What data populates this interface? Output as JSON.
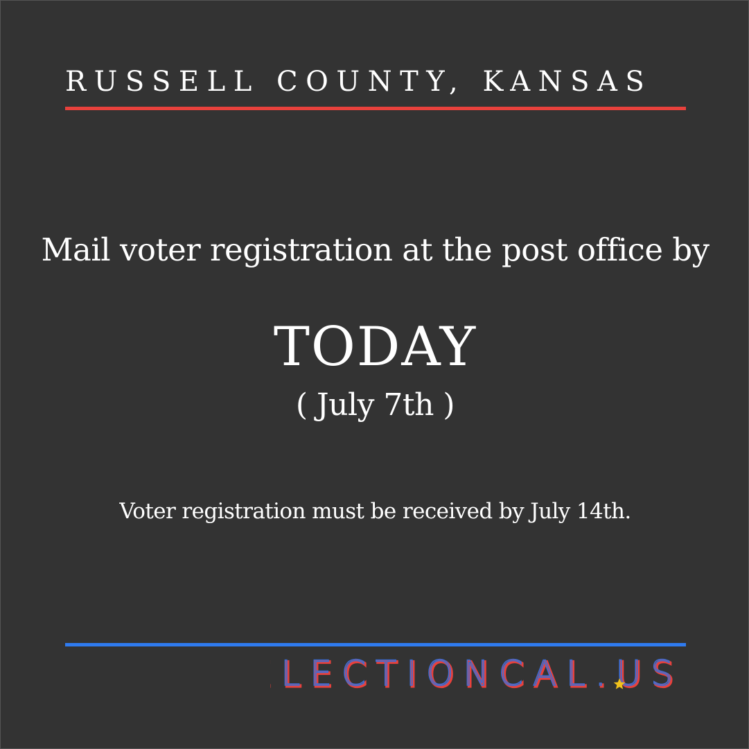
{
  "header": {
    "location": "RUSSELL COUNTY, KANSAS"
  },
  "main": {
    "headline": "Mail voter registration at the post office by",
    "deadline": "TODAY",
    "deadline_date": "( July 7th )",
    "note": "Voter registration must be received by July 14th."
  },
  "footer": {
    "logo_text": "ELECTIONCAL.US"
  },
  "colors": {
    "background": "#333333",
    "accent_red": "#e8413c",
    "accent_blue": "#2f7bf0",
    "star_gold": "#f2c21b",
    "text": "#ffffff"
  },
  "icons": {
    "logo_star": "star-icon"
  }
}
